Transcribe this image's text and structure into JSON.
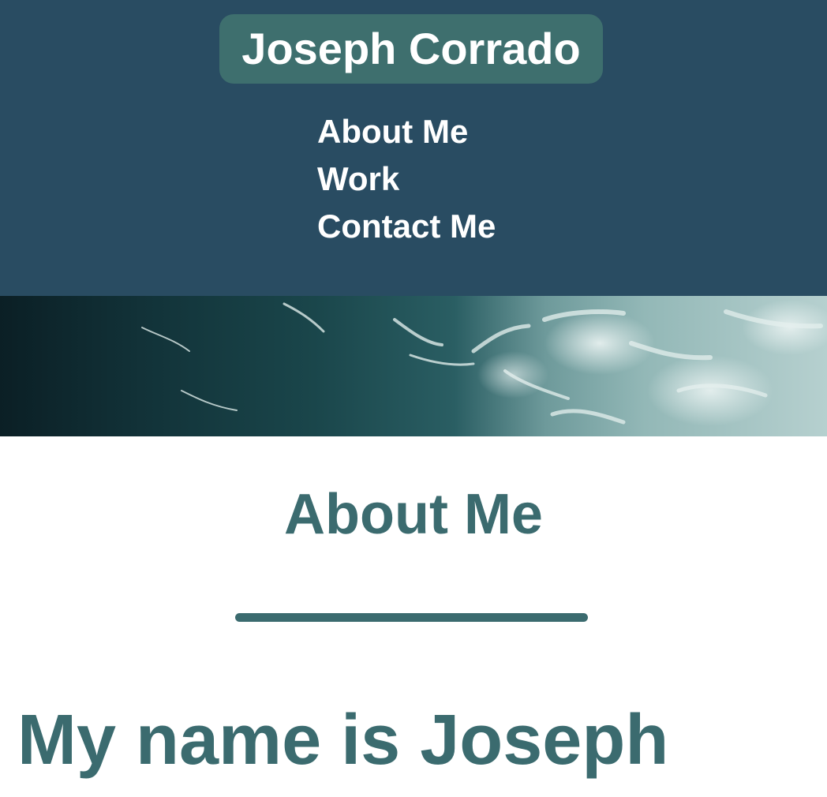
{
  "header": {
    "brand": "Joseph Corrado",
    "nav": [
      {
        "label": "About Me"
      },
      {
        "label": "Work"
      },
      {
        "label": "Contact Me"
      }
    ]
  },
  "hero": {
    "image": "ocean-waves-image"
  },
  "about": {
    "title": "About Me",
    "intro": "My name is Joseph"
  },
  "colors": {
    "header_bg": "#294c62",
    "accent": "#3e6f6e",
    "heading_text": "#3b6b6f",
    "nav_text": "#ffffff"
  }
}
